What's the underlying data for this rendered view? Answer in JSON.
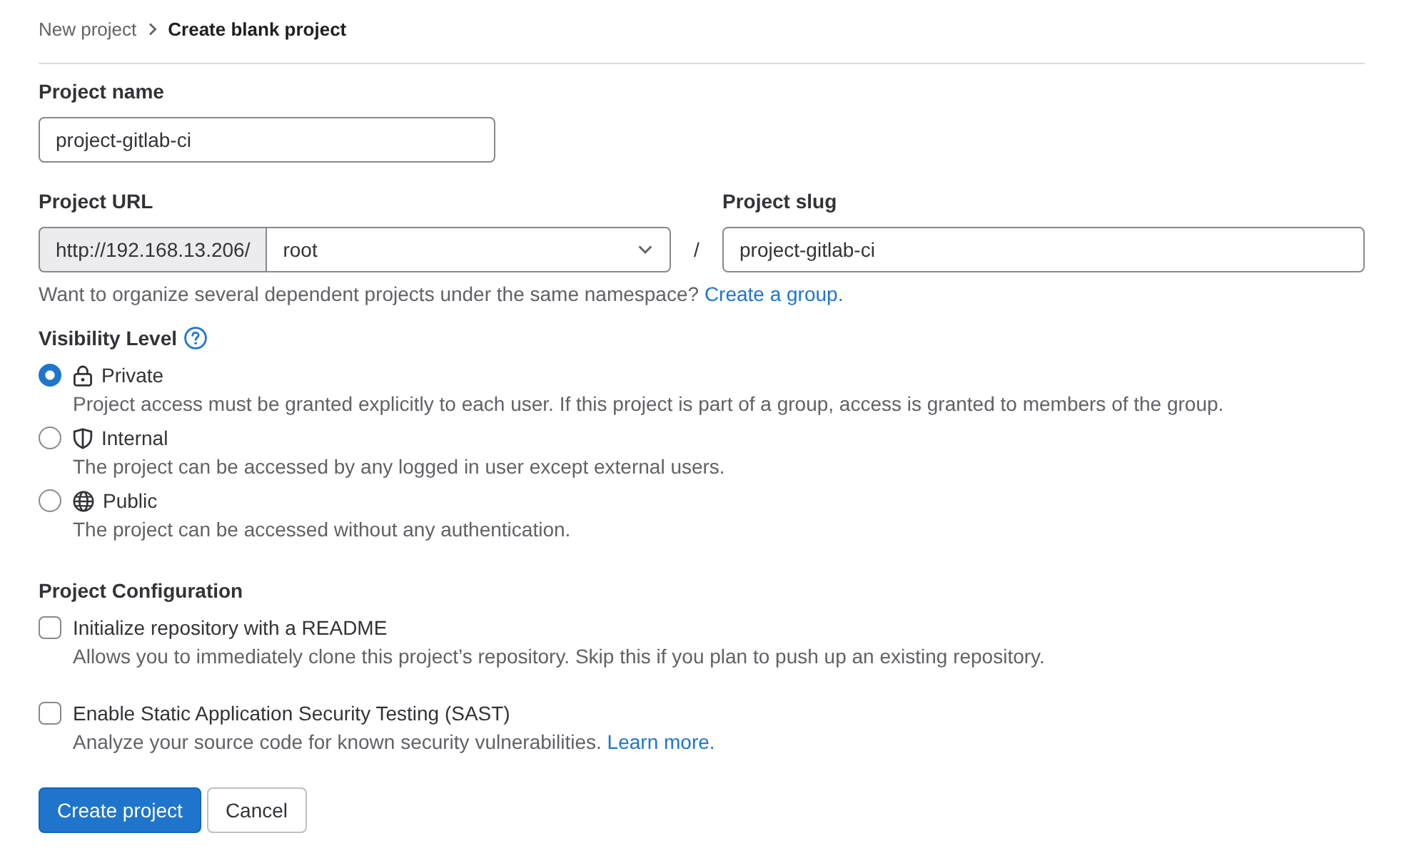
{
  "breadcrumb": [
    {
      "label": "New project",
      "current": false
    },
    {
      "label": "Create blank project",
      "current": true
    }
  ],
  "project_name": {
    "label": "Project name",
    "value": "project-gitlab-ci"
  },
  "project_url": {
    "label": "Project URL",
    "prefix": "http://192.168.13.206/",
    "namespace": "root",
    "separator": "/"
  },
  "project_slug": {
    "label": "Project slug",
    "value": "project-gitlab-ci"
  },
  "namespace_help": {
    "text": "Want to organize several dependent projects under the same namespace?",
    "link": "Create a group."
  },
  "visibility": {
    "label": "Visibility Level",
    "options": [
      {
        "kind": "private",
        "label": "Private",
        "description": "Project access must be granted explicitly to each user. If this project is part of a group, access is granted to members of the group.",
        "selected": true
      },
      {
        "kind": "internal",
        "label": "Internal",
        "description": "The project can be accessed by any logged in user except external users.",
        "selected": false
      },
      {
        "kind": "public",
        "label": "Public",
        "description": "The project can be accessed without any authentication.",
        "selected": false
      }
    ]
  },
  "configuration": {
    "label": "Project Configuration",
    "options": [
      {
        "label": "Initialize repository with a README",
        "description": "Allows you to immediately clone this project’s repository. Skip this if you plan to push up an existing repository.",
        "checked": false
      },
      {
        "label": "Enable Static Application Security Testing (SAST)",
        "description": "Analyze your source code for known security vulnerabilities.",
        "link": "Learn more.",
        "checked": false
      }
    ]
  },
  "buttons": [
    {
      "kind": "primary",
      "label": "Create project"
    },
    {
      "kind": "secondary",
      "label": "Cancel"
    }
  ]
}
